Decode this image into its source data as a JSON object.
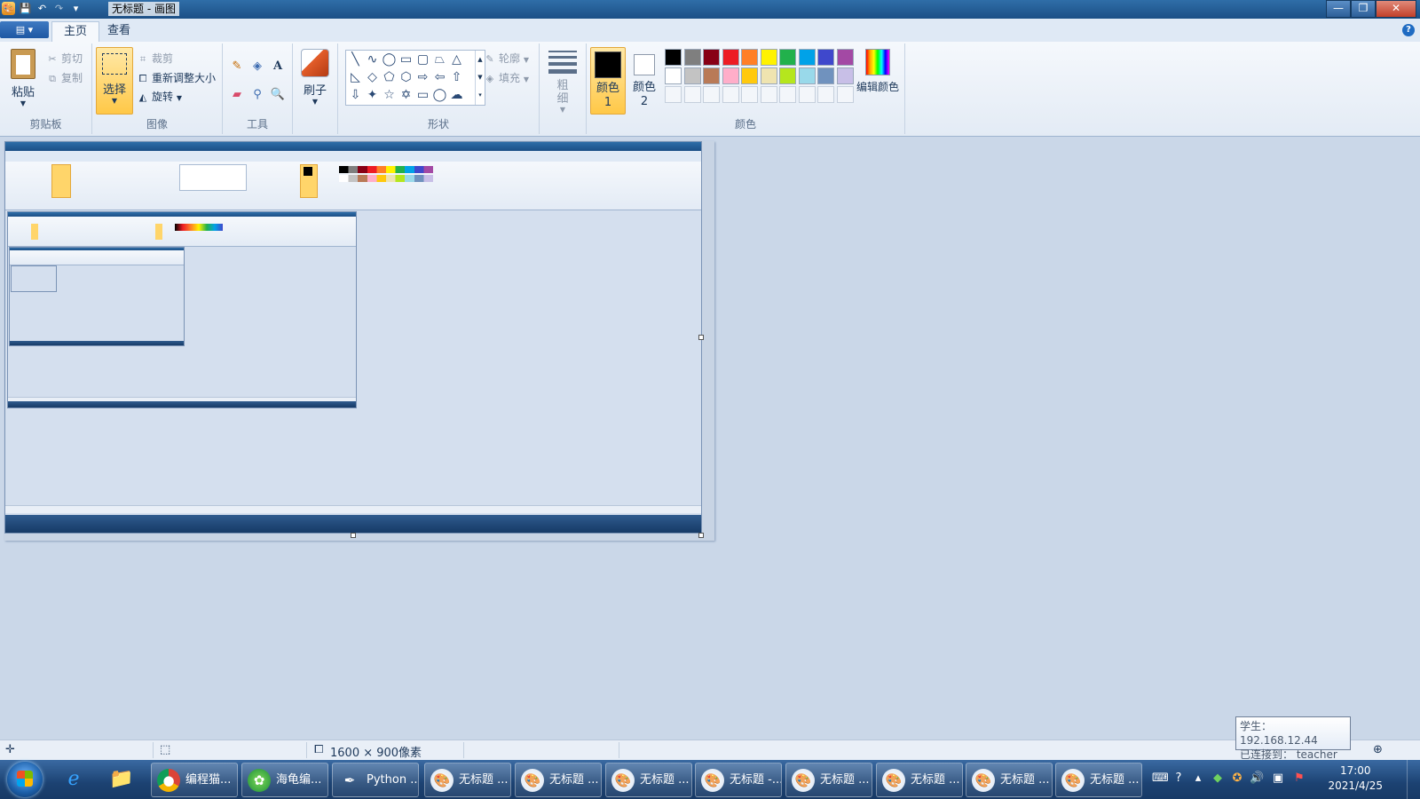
{
  "window": {
    "title": "无标题 - 画图",
    "controls": {
      "minimize": "—",
      "maximize": "❐",
      "close": "✕"
    }
  },
  "tabs": {
    "file_menu": "▤ ▾",
    "home": "主页",
    "view": "查看",
    "help": "?"
  },
  "ribbon": {
    "clipboard": {
      "label": "剪贴板",
      "paste": "粘贴",
      "cut": "剪切",
      "copy": "复制"
    },
    "image": {
      "label": "图像",
      "select": "选择",
      "crop": "裁剪",
      "resize": "重新调整大小",
      "rotate": "旋转"
    },
    "tools": {
      "label": "工具"
    },
    "brushes": {
      "label": "刷子"
    },
    "shapes": {
      "label": "形状",
      "outline": "轮廓",
      "fill": "填充"
    },
    "size": {
      "label": "粗细"
    },
    "colors": {
      "label": "颜色",
      "color1": "颜色 1",
      "color2": "颜色 2",
      "edit_colors": "编辑颜色",
      "color1_value": "#000000",
      "color2_value": "#ffffff",
      "palette_row1": [
        "#000000",
        "#7f7f7f",
        "#880015",
        "#ed1c24",
        "#ff7f27",
        "#fff200",
        "#22b14c",
        "#00a2e8",
        "#3f48cc",
        "#a349a4"
      ],
      "palette_row2": [
        "#ffffff",
        "#c3c3c3",
        "#b97a57",
        "#ffaec9",
        "#ffc90e",
        "#efe4b0",
        "#b5e61d",
        "#99d9ea",
        "#7092be",
        "#c8bfe7"
      ]
    }
  },
  "statusbar": {
    "canvas_size": "1600 × 900像素"
  },
  "taskbar": {
    "buttons": [
      {
        "label": "编程猫...",
        "icon": "chrome-icon"
      },
      {
        "label": "海龟编...",
        "icon": "turtle-editor-icon"
      },
      {
        "label": "Python ...",
        "icon": "python-idle-icon"
      },
      {
        "label": "无标题 ...",
        "icon": "paint-icon"
      },
      {
        "label": "无标题 ...",
        "icon": "paint-icon"
      },
      {
        "label": "无标题 ...",
        "icon": "paint-icon"
      },
      {
        "label": "无标题 -...",
        "icon": "paint-icon"
      },
      {
        "label": "无标题 ...",
        "icon": "paint-icon"
      },
      {
        "label": "无标题 ...",
        "icon": "paint-icon"
      },
      {
        "label": "无标题 ...",
        "icon": "paint-icon"
      },
      {
        "label": "无标题 ...",
        "icon": "paint-icon"
      }
    ],
    "clock_time": "17:00",
    "clock_date": "2021/4/25"
  },
  "tooltip": {
    "line1": "学生： 192.168.12.44",
    "line2": "已连接到： teacher"
  }
}
